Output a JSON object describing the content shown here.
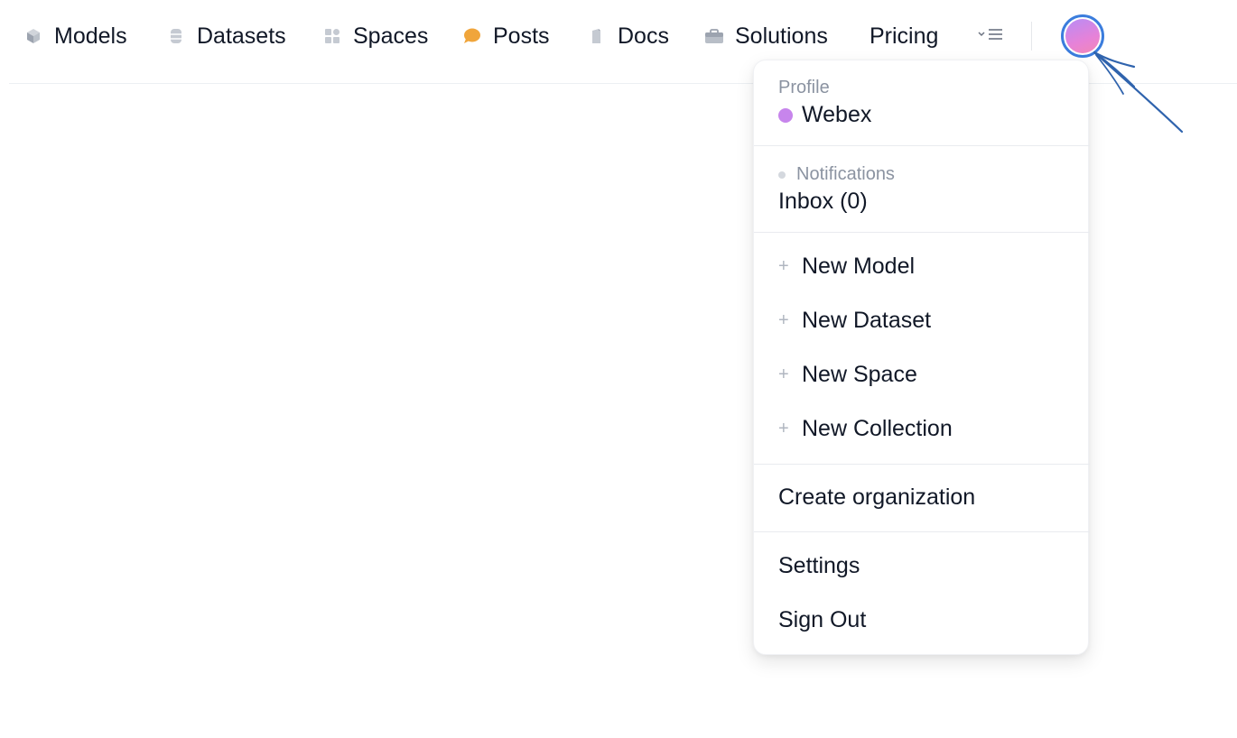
{
  "nav": {
    "items": [
      {
        "label": "Models",
        "icon": "cube-icon"
      },
      {
        "label": "Datasets",
        "icon": "database-icon"
      },
      {
        "label": "Spaces",
        "icon": "grid-icon"
      },
      {
        "label": "Posts",
        "icon": "speech-bubble-icon"
      },
      {
        "label": "Docs",
        "icon": "document-icon"
      },
      {
        "label": "Solutions",
        "icon": "briefcase-icon"
      },
      {
        "label": "Pricing",
        "icon": ""
      }
    ],
    "more_icon": "chevron-menu-icon"
  },
  "menu": {
    "profile_label": "Profile",
    "profile_name": "Webex",
    "notifications_label": "Notifications",
    "inbox": "Inbox (0)",
    "new_model": "New Model",
    "new_dataset": "New Dataset",
    "new_space": "New Space",
    "new_collection": "New Collection",
    "create_org": "Create organization",
    "settings": "Settings",
    "sign_out": "Sign Out"
  },
  "colors": {
    "annotation_arrow": "#2f63ad",
    "avatar_ring": "#3b7ddd",
    "posts_icon": "#f0a53b"
  }
}
